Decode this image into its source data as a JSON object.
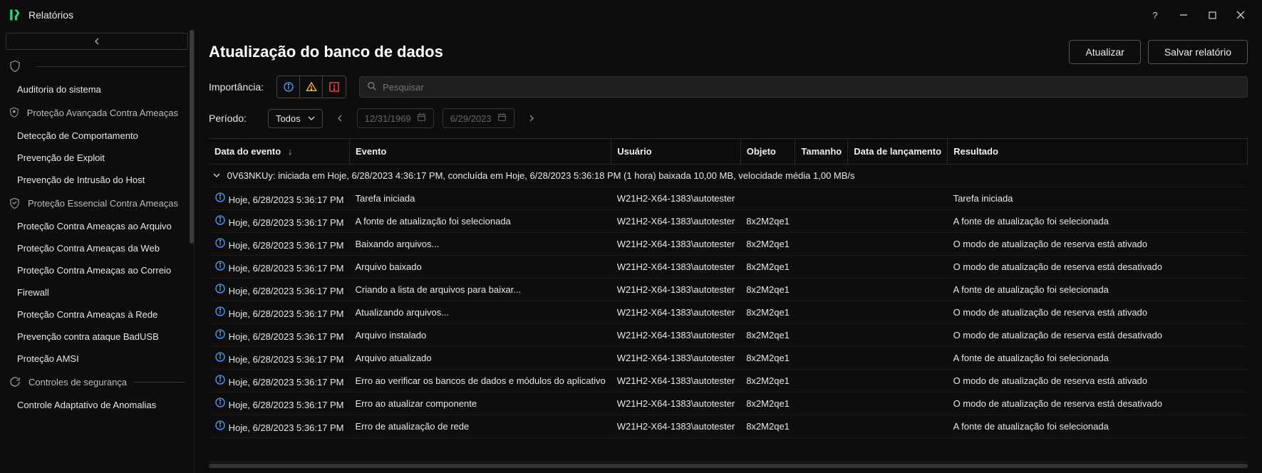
{
  "window": {
    "title": "Relatórios"
  },
  "sidebar": {
    "section_shield_only": "",
    "items0": [
      {
        "label": "Auditoria do sistema"
      }
    ],
    "section_advanced": "Proteção Avançada Contra Ameaças",
    "items1": [
      {
        "label": "Detecção de Comportamento"
      },
      {
        "label": "Prevenção de Exploit"
      },
      {
        "label": "Prevenção de Intrusão do Host"
      }
    ],
    "section_essential": "Proteção Essencial Contra Ameaças",
    "items2": [
      {
        "label": "Proteção Contra Ameaças ao Arquivo"
      },
      {
        "label": "Proteção Contra Ameaças da Web"
      },
      {
        "label": "Proteção Contra Ameaças ao Correio"
      },
      {
        "label": "Firewall"
      },
      {
        "label": "Proteção Contra Ameaças à Rede"
      },
      {
        "label": "Prevenção contra ataque BadUSB"
      },
      {
        "label": "Proteção AMSI"
      }
    ],
    "section_controls": "Controles de segurança",
    "items3": [
      {
        "label": "Controle Adaptativo de Anomalias"
      }
    ]
  },
  "header": {
    "page_title": "Atualização do banco de dados",
    "update_btn": "Atualizar",
    "save_btn": "Salvar relatório"
  },
  "filters": {
    "importance_label": "Importância:",
    "search_placeholder": "Pesquisar",
    "period_label": "Período:",
    "period_value": "Todos",
    "date_from": "12/31/1969",
    "date_to": "6/29/2023"
  },
  "table": {
    "columns": {
      "date": "Data do evento",
      "event": "Evento",
      "user": "Usuário",
      "object": "Objeto",
      "size": "Tamanho",
      "release": "Data de lançamento",
      "result": "Resultado"
    },
    "group_summary": "0V63NKUy: iniciada em Hoje, 6/28/2023 4:36:17 PM, concluída em Hoje, 6/28/2023 5:36:18 PM (1 hora) baixada 10,00 MB, velocidade média 1,00 MB/s",
    "rows": [
      {
        "date": "Hoje, 6/28/2023 5:36:17 PM",
        "event": "Tarefa iniciada",
        "user": "W21H2-X64-1383\\autotester",
        "object": "",
        "result": "Tarefa iniciada"
      },
      {
        "date": "Hoje, 6/28/2023 5:36:17 PM",
        "event": "A fonte de atualização foi selecionada",
        "user": "W21H2-X64-1383\\autotester",
        "object": "8x2M2qe1",
        "result": "A fonte de atualização foi selecionada"
      },
      {
        "date": "Hoje, 6/28/2023 5:36:17 PM",
        "event": "Baixando arquivos...",
        "user": "W21H2-X64-1383\\autotester",
        "object": "8x2M2qe1",
        "result": "O modo de atualização de reserva está ativado"
      },
      {
        "date": "Hoje, 6/28/2023 5:36:17 PM",
        "event": "Arquivo baixado",
        "user": "W21H2-X64-1383\\autotester",
        "object": "8x2M2qe1",
        "result": "O modo de atualização de reserva está desativado"
      },
      {
        "date": "Hoje, 6/28/2023 5:36:17 PM",
        "event": "Criando a lista de arquivos para baixar...",
        "user": "W21H2-X64-1383\\autotester",
        "object": "8x2M2qe1",
        "result": "A fonte de atualização foi selecionada"
      },
      {
        "date": "Hoje, 6/28/2023 5:36:17 PM",
        "event": "Atualizando arquivos...",
        "user": "W21H2-X64-1383\\autotester",
        "object": "8x2M2qe1",
        "result": "O modo de atualização de reserva está ativado"
      },
      {
        "date": "Hoje, 6/28/2023 5:36:17 PM",
        "event": "Arquivo instalado",
        "user": "W21H2-X64-1383\\autotester",
        "object": "8x2M2qe1",
        "result": "O modo de atualização de reserva está desativado"
      },
      {
        "date": "Hoje, 6/28/2023 5:36:17 PM",
        "event": "Arquivo atualizado",
        "user": "W21H2-X64-1383\\autotester",
        "object": "8x2M2qe1",
        "result": "A fonte de atualização foi selecionada"
      },
      {
        "date": "Hoje, 6/28/2023 5:36:17 PM",
        "event": "Erro ao verificar os bancos de dados e módulos do aplicativo",
        "user": "W21H2-X64-1383\\autotester",
        "object": "8x2M2qe1",
        "result": "O modo de atualização de reserva está ativado"
      },
      {
        "date": "Hoje, 6/28/2023 5:36:17 PM",
        "event": "Erro ao atualizar componente",
        "user": "W21H2-X64-1383\\autotester",
        "object": "8x2M2qe1",
        "result": "O modo de atualização de reserva está desativado"
      },
      {
        "date": "Hoje, 6/28/2023 5:36:17 PM",
        "event": "Erro de atualização de rede",
        "user": "W21H2-X64-1383\\autotester",
        "object": "8x2M2qe1",
        "result": "A fonte de atualização foi selecionada"
      }
    ]
  }
}
